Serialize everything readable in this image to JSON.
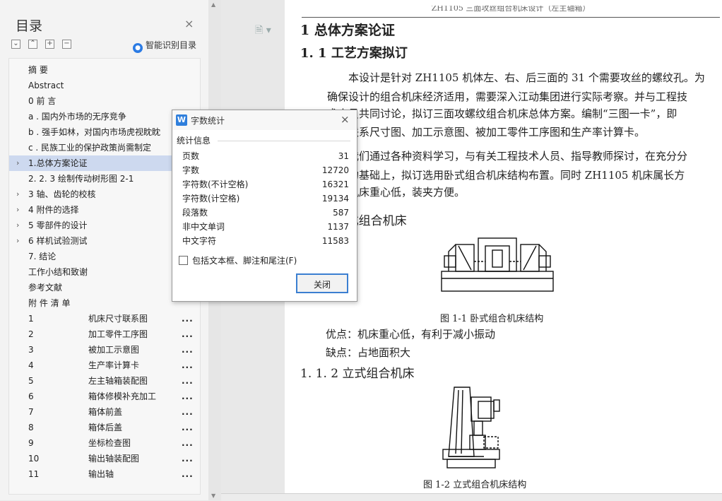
{
  "toc": {
    "title": "目录",
    "close": "×",
    "tools": [
      "⌄",
      "⌃",
      "+",
      "−"
    ],
    "smart_label": "智能识别目录",
    "items": [
      {
        "label": "摘  要",
        "arrow": ""
      },
      {
        "label": "Abstract",
        "arrow": ""
      },
      {
        "label": "0  前  言",
        "arrow": ""
      },
      {
        "label": "a . 国内外市场的无序竞争",
        "arrow": ""
      },
      {
        "label": "b . 强手如林，对国内市场虎视眈眈",
        "arrow": ""
      },
      {
        "label": "c .  民族工业的保护政策尚需制定",
        "arrow": ""
      },
      {
        "label": "1.总体方案论证",
        "arrow": "›",
        "selected": true
      },
      {
        "label": "2. 2. 3  绘制传动树形图 2-1",
        "arrow": ""
      },
      {
        "label": "3  轴、齿轮的校核",
        "arrow": "›"
      },
      {
        "label": "4  附件的选择",
        "arrow": "›"
      },
      {
        "label": "5  零部件的设计",
        "arrow": "›"
      },
      {
        "label": "6  样机试验测试",
        "arrow": "›"
      },
      {
        "label": "7. 结论",
        "arrow": ""
      },
      {
        "label": "工作小结和致谢",
        "arrow": ""
      },
      {
        "label": "参考文献",
        "arrow": ""
      },
      {
        "label": "附 件 清 单",
        "arrow": ""
      }
    ],
    "attachments": [
      {
        "num": "1",
        "name": "机床尺寸联系图",
        "dots": "..."
      },
      {
        "num": "2",
        "name": "加工零件工序图",
        "dots": "..."
      },
      {
        "num": "3",
        "name": "被加工示意图",
        "dots": "..."
      },
      {
        "num": "4",
        "name": "生产率计算卡",
        "dots": "..."
      },
      {
        "num": "5",
        "name": "左主轴箱装配图",
        "dots": "..."
      },
      {
        "num": "6",
        "name": "箱体修模补充加工",
        "dots": "..."
      },
      {
        "num": "7",
        "name": "箱体前盖",
        "dots": "..."
      },
      {
        "num": "8",
        "name": "箱体后盖",
        "dots": "..."
      },
      {
        "num": "9",
        "name": "坐标检查图",
        "dots": "..."
      },
      {
        "num": "10",
        "name": "输出轴装配图",
        "dots": "..."
      },
      {
        "num": "11",
        "name": "输出轴",
        "dots": "..."
      }
    ]
  },
  "dialog": {
    "title": "字数统计",
    "close": "×",
    "group_label": "统计信息",
    "stats": [
      {
        "key": "页数",
        "value": "31"
      },
      {
        "key": "字数",
        "value": "12720"
      },
      {
        "key": "字符数(不计空格)",
        "value": "16321"
      },
      {
        "key": "字符数(计空格)",
        "value": "19134"
      },
      {
        "key": "段落数",
        "value": "587"
      },
      {
        "key": "非中文单词",
        "value": "1137"
      },
      {
        "key": "中文字符",
        "value": "11583"
      }
    ],
    "checkbox_label": "包括文本框、脚注和尾注(F)",
    "close_button": "关闭"
  },
  "document": {
    "header": "ZH1105 三面攻丝组合机床设计（左主轴箱）",
    "h1": "1   总体方案论证",
    "h2": "1. 1    工艺方案拟订",
    "para1": [
      "本设计是针对 ZH1105 机体左、右、后三面的 31 个需要攻丝的螺纹孔。为",
      "确保设计的组合机床经济适用，需要深入江动集团进行实际考察。并与工程技",
      "术人员共同讨论，拟订三面攻螺纹组合机床总体方案。编制“三图一卡”，即",
      "机床联系尺寸图、加工示意图、被加工零件工序图和生产率计算卡。"
    ],
    "para2": [
      "我们通过各种资料学习，与有关工程技术人员、指导教师探讨，在充分分",
      "比较的基础上，拟订选用卧式组合机床结构布置。同时 ZH1105 机床属长方",
      "组合机床重心低，装夹方便。"
    ],
    "h3a": "1.1.1  卧式组合机床",
    "fig1_caption": "图 1-1  卧式组合机床结构",
    "pros": "优点：机床重心低，有利于减小振动",
    "cons": "缺点：占地面积大",
    "h3b": "1. 1. 2  立式组合机床",
    "fig2_caption": "图 1-2  立式组合机床结构"
  }
}
